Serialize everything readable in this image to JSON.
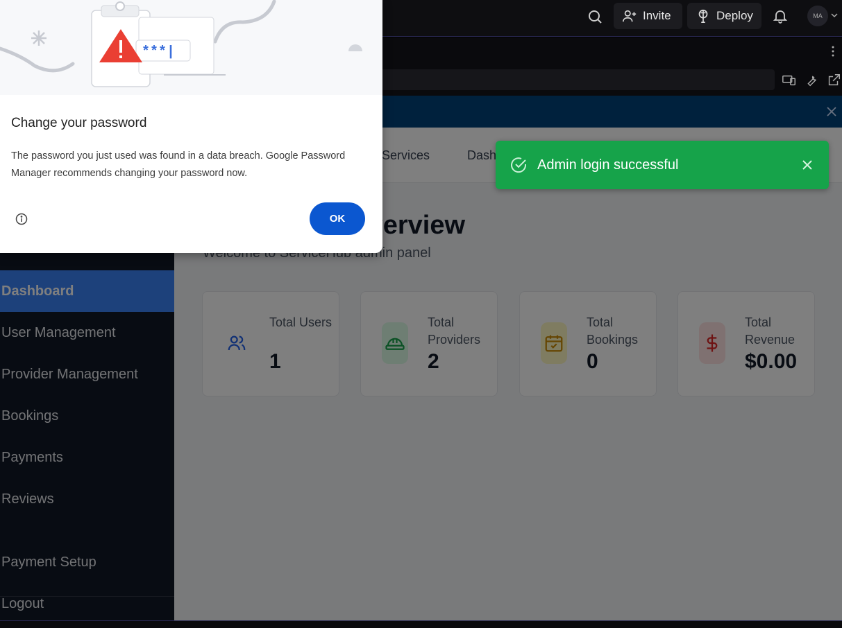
{
  "topbar": {
    "invite_label": "Invite",
    "deploy_label": "Deploy",
    "avatar_initials": "MA"
  },
  "app": {
    "nav_links": [
      "Services",
      "Dash"
    ],
    "page_title": "Dashboard Overview",
    "page_title_visible": "erview",
    "subtitle": "Welcome to ServiceHub admin panel"
  },
  "sidebar": {
    "items": [
      "Dashboard",
      "User Management",
      "Provider Management",
      "Bookings",
      "Payments",
      "Reviews",
      "Payment Setup",
      "Logout"
    ],
    "active_index": 0
  },
  "stats": [
    {
      "label": "Total Users",
      "value": "1",
      "icon": "users-icon",
      "color": "#2563eb",
      "bg": "#ffffff"
    },
    {
      "label": "Total Providers",
      "value": "2",
      "icon": "hard-hat-icon",
      "color": "#16a34a",
      "bg": "#dcfce7"
    },
    {
      "label": "Total Bookings",
      "value": "0",
      "icon": "calendar-check-icon",
      "color": "#ca8a04",
      "bg": "#fef9c3"
    },
    {
      "label": "Total Revenue",
      "value": "$0.00",
      "icon": "dollar-icon",
      "color": "#dc2626",
      "bg": "#fee2e2"
    }
  ],
  "toast": {
    "message": "Admin login successful",
    "color": "#16a34a"
  },
  "dialog": {
    "title": "Change your password",
    "body": "The password you just used was found in a data breach. Google Password Manager recommends changing your password now.",
    "ok_label": "OK",
    "masked_password": "***|"
  }
}
